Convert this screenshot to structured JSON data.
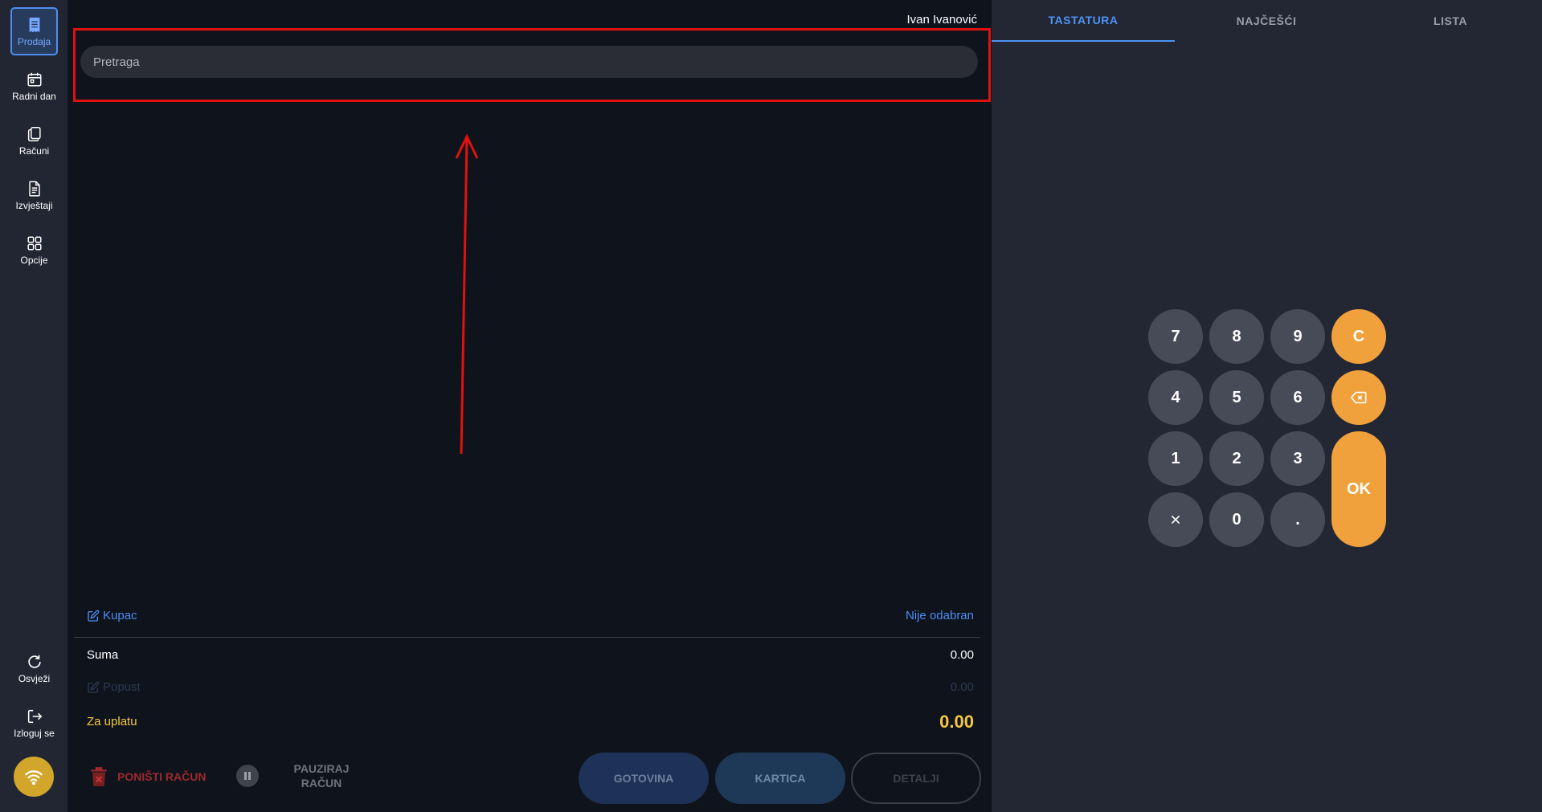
{
  "sidebar": {
    "items": [
      {
        "label": "Prodaja",
        "icon": "receipt-icon"
      },
      {
        "label": "Radni dan",
        "icon": "calendar-icon"
      },
      {
        "label": "Računi",
        "icon": "documents-icon"
      },
      {
        "label": "Izvještaji",
        "icon": "report-icon"
      },
      {
        "label": "Opcije",
        "icon": "grid-icon"
      },
      {
        "label": "Osvježi",
        "icon": "refresh-icon"
      },
      {
        "label": "Izloguj se",
        "icon": "logout-icon"
      }
    ],
    "status_icon": "wifi-icon"
  },
  "header": {
    "user_name": "Ivan Ivanović"
  },
  "search": {
    "placeholder": "Pretraga",
    "value": ""
  },
  "summary": {
    "kupac_label": "Kupac",
    "kupac_value": "Nije odabran",
    "suma_label": "Suma",
    "suma_value": "0.00",
    "popust_label": "Popust",
    "popust_value": "0.00",
    "za_uplatu_label": "Za uplatu",
    "za_uplatu_value": "0.00"
  },
  "actions": {
    "cancel_label": "PONIŠTI RAČUN",
    "pause_label_line1": "PAUZIRAJ",
    "pause_label_line2": "RAČUN",
    "cash_label": "GOTOVINA",
    "card_label": "KARTICA",
    "details_label": "DETALJI"
  },
  "tabs": [
    {
      "label": "TASTATURA",
      "active": true
    },
    {
      "label": "NAJČEŠĆI",
      "active": false
    },
    {
      "label": "LISTA",
      "active": false
    }
  ],
  "keypad": {
    "keys": [
      "7",
      "8",
      "9",
      "C",
      "4",
      "5",
      "6",
      "1",
      "2",
      "3",
      "OK",
      "0",
      "."
    ],
    "backspace_icon": "backspace-icon",
    "multiply_icon": "multiply-icon"
  },
  "colors": {
    "accent": "#4d93f5",
    "orange": "#f0a13c",
    "highlight": "#e0120f",
    "za_uplatu": "#f5c842"
  }
}
